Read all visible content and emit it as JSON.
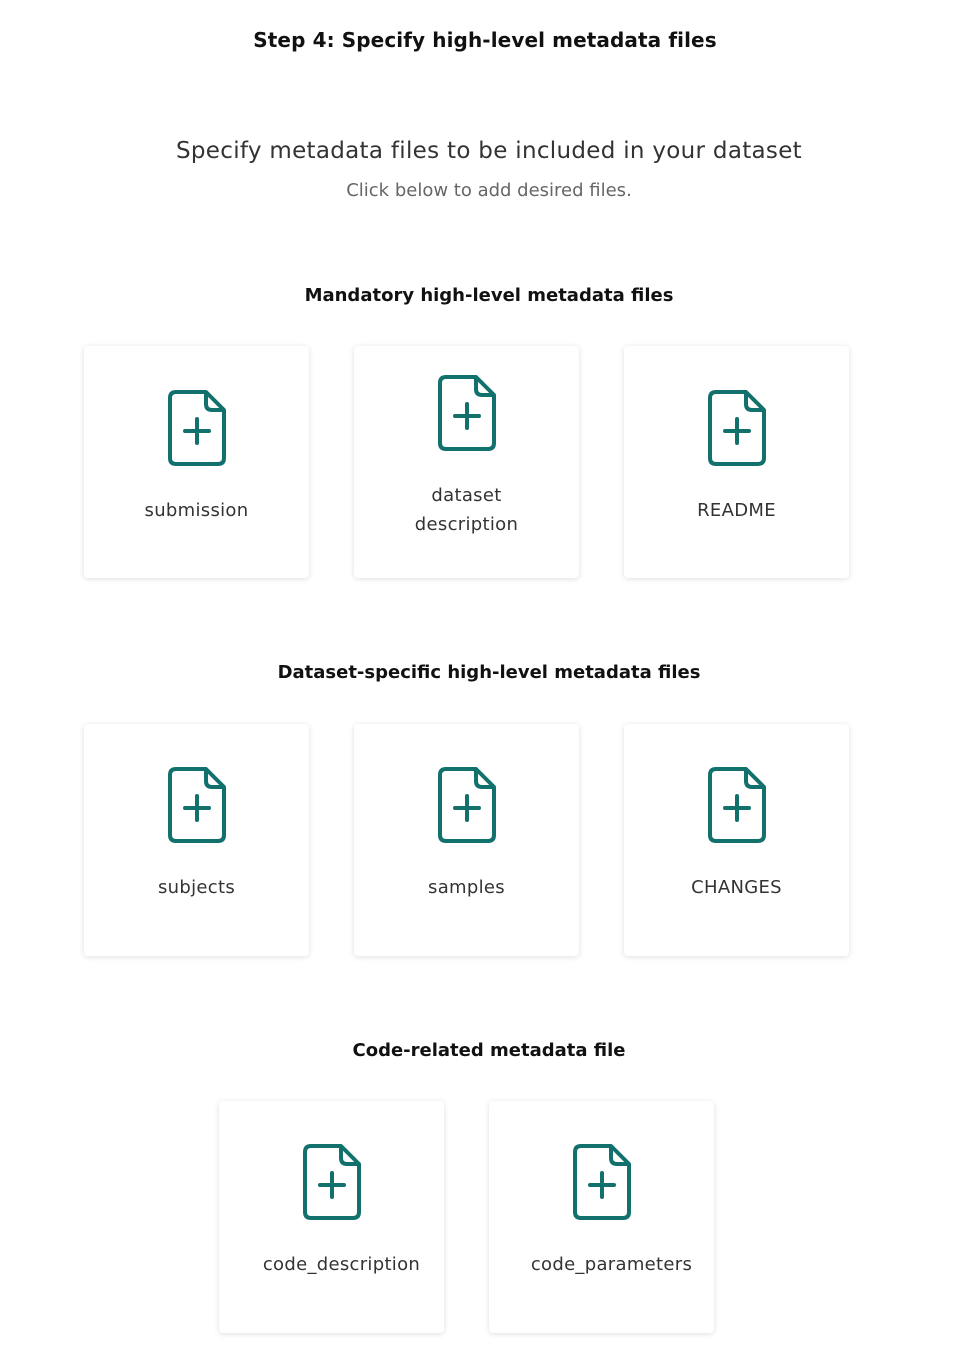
{
  "step_title": "Step 4: Specify high-level metadata files",
  "main_heading": "Specify metadata files to be included in your dataset",
  "sub_heading": "Click below to add desired files.",
  "colors": {
    "icon_accent": "#13716d"
  },
  "icon_name": "file-plus-icon",
  "sections": [
    {
      "title": "Mandatory high-level metadata files",
      "cards": [
        {
          "label": "submission"
        },
        {
          "label": "dataset\ndescription"
        },
        {
          "label": "README"
        }
      ]
    },
    {
      "title": "Dataset-specific high-level metadata files",
      "cards": [
        {
          "label": "subjects"
        },
        {
          "label": "samples"
        },
        {
          "label": "CHANGES"
        }
      ]
    },
    {
      "title": "Code-related metadata file",
      "cards": [
        {
          "label": "code_description"
        },
        {
          "label": "code_parameters"
        }
      ]
    }
  ]
}
